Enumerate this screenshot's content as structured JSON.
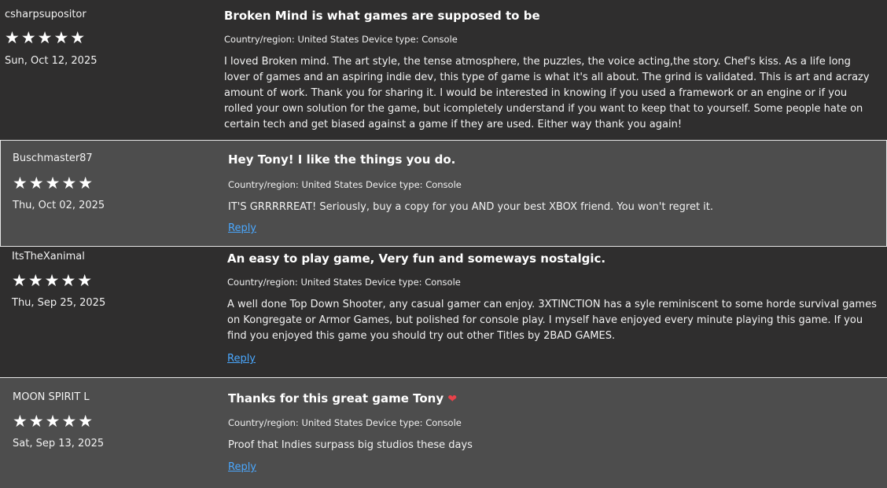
{
  "reviews": [
    {
      "author": "csharpsupositor",
      "stars": "★★★★★",
      "date": "Sun, Oct 12, 2025",
      "title": "Broken Mind is what games are supposed to be",
      "meta": "Country/region: United States Device type: Console",
      "body": "I loved Broken mind. The art style, the tense atmosphere, the puzzles, the voice acting,the story. Chef's kiss. As a life long lover of games and an aspiring indie dev, this type of game is what it's all about. The grind is validated. This is art and acrazy amount of work. Thank you for sharing it. I would be interested in knowing if you used a framework or an engine or if you rolled your own solution for the game, but icompletely understand if you want to keep that to yourself. Some people hate on certain tech and get biased against a game if they are used. Either way thank you again!",
      "rating": 5
    },
    {
      "author": "Buschmaster87",
      "stars": "★★★★★",
      "date": "Thu, Oct 02, 2025",
      "title": "Hey Tony! I like the things you do.",
      "meta": "Country/region: United States Device type: Console",
      "body": "IT'S GRRRRREAT! Seriously, buy a copy for you AND your best XBOX friend. You won't regret it.",
      "reply": "Reply",
      "rating": 5
    },
    {
      "author": "ItsTheXanimal",
      "stars": "★★★★★",
      "date": "Thu, Sep 25, 2025",
      "title": "An easy to play game, Very fun and someways nostalgic.",
      "meta": "Country/region: United States Device type: Console",
      "body": "A well done Top Down Shooter, any casual gamer can enjoy. 3XTINCTION has a syle reminiscent to some horde survival games on Kongregate or Armor Games, but polished for console play. I myself have enjoyed every minute playing this game. If you find you enjoyed this game you should try out other Titles by 2BAD GAMES.",
      "reply": "Reply",
      "rating": 5
    },
    {
      "author": "MOON SPIRIT L",
      "stars": "★★★★★",
      "date": "Sat, Sep 13, 2025",
      "title": "Thanks for this great game Tony",
      "title_emoji": "❤",
      "meta": "Country/region: United States Device type: Console",
      "body": "Proof that Indies surpass big studios these days",
      "reply": "Reply",
      "rating": 5
    }
  ],
  "colors": {
    "dark_row": "#2f2e2e",
    "light_row": "#4d4d4d",
    "link": "#4aa8ff",
    "heart": "#e8424a"
  }
}
